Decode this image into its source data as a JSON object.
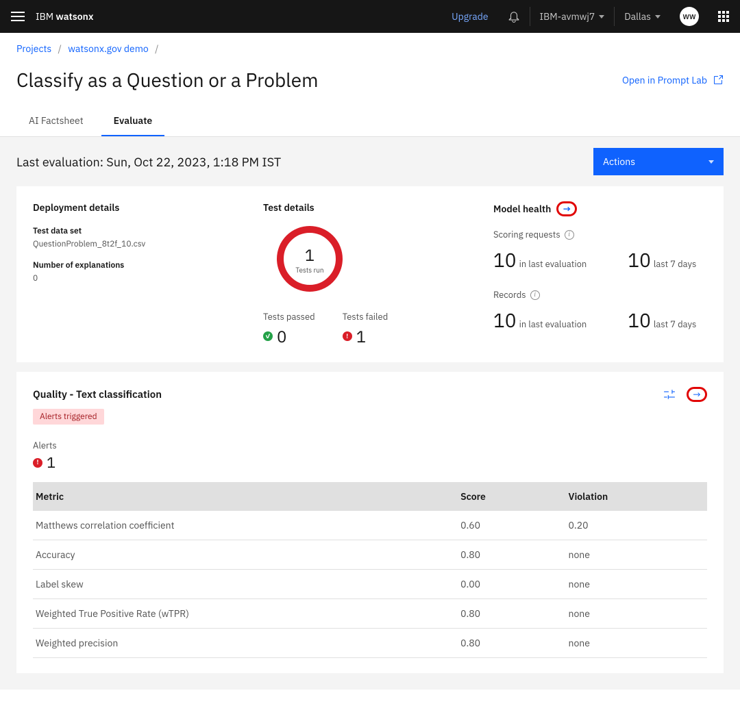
{
  "topbar": {
    "brand_prefix": "IBM ",
    "brand_name": "watsonx",
    "upgrade": "Upgrade",
    "account": "IBM-avmwj7",
    "region": "Dallas",
    "avatar": "WW"
  },
  "breadcrumb": {
    "projects": "Projects",
    "project_name": "watsonx.gov demo"
  },
  "page_title": "Classify as a Question or a Problem",
  "open_in_lab": "Open in Prompt Lab",
  "tabs": {
    "factsheet": "AI Factsheet",
    "evaluate": "Evaluate"
  },
  "last_eval_label": "Last evaluation: ",
  "last_eval_value": "Sun, Oct 22, 2023, 1:18 PM IST",
  "actions": "Actions",
  "deployment": {
    "heading": "Deployment details",
    "dataset_label": "Test data set",
    "dataset_value": "QuestionProblem_8t2f_10.csv",
    "explanations_label": "Number of explanations",
    "explanations_value": "0"
  },
  "test": {
    "heading": "Test details",
    "tests_run_value": "1",
    "tests_run_label": "Tests run",
    "passed_label": "Tests passed",
    "passed_value": "0",
    "failed_label": "Tests failed",
    "failed_value": "1"
  },
  "model_health": {
    "heading": "Model health",
    "scoring_label": "Scoring requests",
    "records_label": "Records",
    "in_last": "in last evaluation",
    "last7": "last 7 days",
    "scoring_eval": "10",
    "scoring_7d": "10",
    "records_eval": "10",
    "records_7d": "10"
  },
  "quality": {
    "heading": "Quality - Text classification",
    "badge": "Alerts triggered",
    "alerts_label": "Alerts",
    "alerts_value": "1",
    "columns": {
      "metric": "Metric",
      "score": "Score",
      "violation": "Violation"
    },
    "rows": [
      {
        "metric": "Matthews correlation coefficient",
        "score": "0.60",
        "violation": "0.20"
      },
      {
        "metric": "Accuracy",
        "score": "0.80",
        "violation": "none"
      },
      {
        "metric": "Label skew",
        "score": "0.00",
        "violation": "none"
      },
      {
        "metric": "Weighted True Positive Rate (wTPR)",
        "score": "0.80",
        "violation": "none"
      },
      {
        "metric": "Weighted precision",
        "score": "0.80",
        "violation": "none"
      }
    ]
  }
}
